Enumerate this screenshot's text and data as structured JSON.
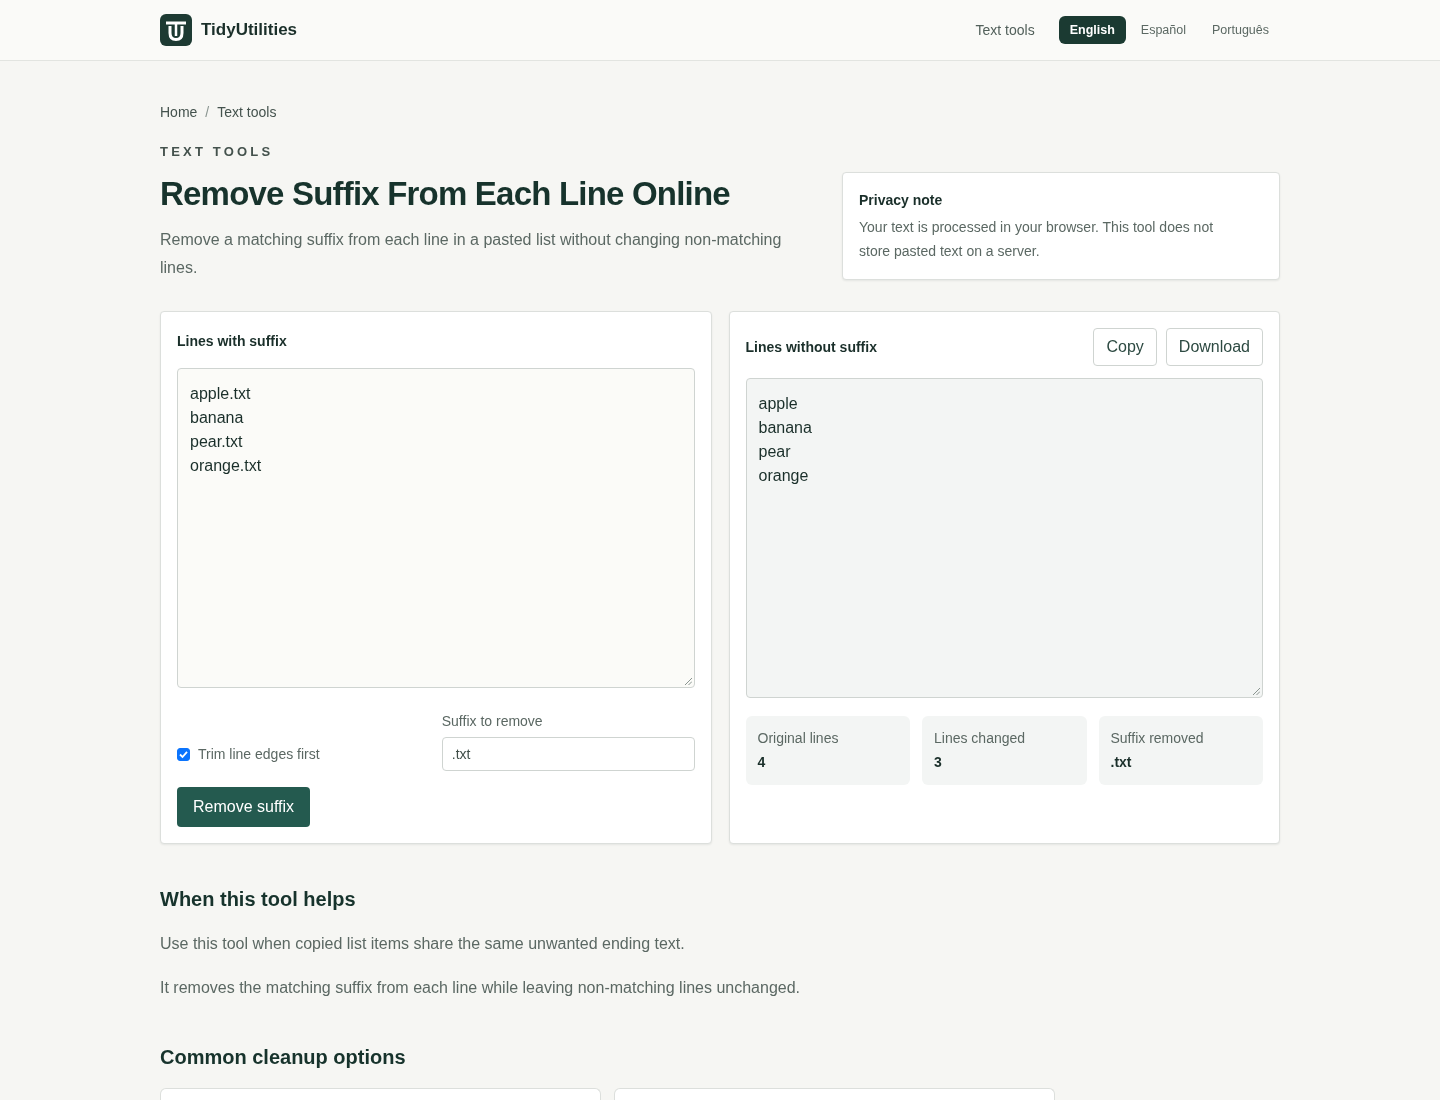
{
  "header": {
    "brand": "TidyUtilities",
    "nav_link": "Text tools",
    "languages": [
      {
        "label": "English",
        "selected": true
      },
      {
        "label": "Español",
        "selected": false
      },
      {
        "label": "Português",
        "selected": false
      }
    ]
  },
  "breadcrumb": {
    "items": [
      "Home",
      "Text tools"
    ],
    "separator": "/"
  },
  "eyebrow": "TEXT TOOLS",
  "title": "Remove Suffix From Each Line Online",
  "intro": "Remove a matching suffix from each line in a pasted list without changing non-matching lines.",
  "privacy": {
    "title": "Privacy note",
    "text": "Your text is processed in your browser. This tool does not store pasted text on a server."
  },
  "input_panel": {
    "label": "Lines with suffix",
    "value": "apple.txt\nbanana\npear.txt\norange.txt",
    "trim": {
      "label": "Trim line edges first",
      "checked": true
    },
    "suffix": {
      "label": "Suffix to remove",
      "value": ".txt"
    },
    "button": "Remove suffix"
  },
  "output_panel": {
    "label": "Lines without suffix",
    "buttons": [
      "Copy",
      "Download"
    ],
    "value": "apple\nbanana\npear\norange",
    "stats": [
      {
        "label": "Original lines",
        "value": "4"
      },
      {
        "label": "Lines changed",
        "value": "3"
      },
      {
        "label": "Suffix removed",
        "value": ".txt"
      }
    ]
  },
  "help": {
    "heading": "When this tool helps",
    "paragraphs": [
      "Use this tool when copied list items share the same unwanted ending text.",
      "It removes the matching suffix from each line while leaving non-matching lines unchanged."
    ]
  },
  "options": {
    "heading": "Common cleanup options",
    "cards": [
      {
        "kind": "card"
      },
      {
        "kind": "card"
      }
    ]
  }
}
